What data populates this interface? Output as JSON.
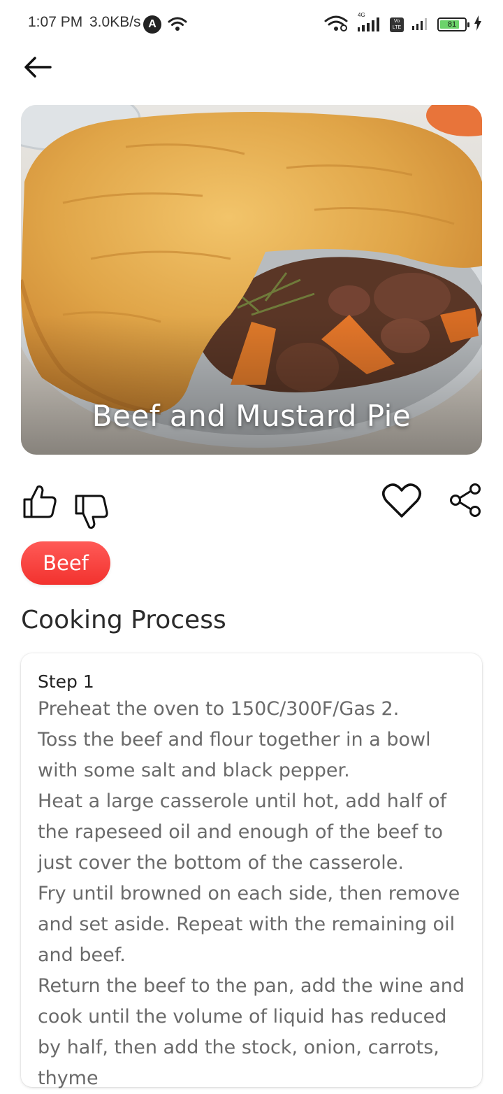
{
  "status_bar": {
    "time": "1:07 PM",
    "speed": "3.0KB/s",
    "indicator_letter": "A",
    "network_label": "4G",
    "volte_label": "Vo LTE",
    "battery_percent": 81,
    "battery_text": "81"
  },
  "header": {
    "back_icon": "arrow-left-icon"
  },
  "recipe": {
    "title": "Beef and Mustard Pie",
    "category": "Beef",
    "actions": [
      "thumbs-up-icon",
      "thumbs-down-icon",
      "heart-icon",
      "share-icon"
    ]
  },
  "cooking": {
    "section_title": "Cooking Process",
    "step_label": "Step 1",
    "step_text": "Preheat the oven to 150C/300F/Gas 2.\nToss the beef and flour together in a bowl with some salt and black pepper.\nHeat a large casserole until hot, add half of the rapeseed oil and enough of the beef to just cover the bottom of the casserole.\nFry until browned on each side, then remove and set aside. Repeat with the remaining oil and beef.\nReturn the beef to the pan, add the wine and cook until the volume of liquid has reduced by half, then add the stock, onion, carrots, thyme"
  },
  "colors": {
    "chip": "#f2322e",
    "battery": "#6cd36a"
  }
}
